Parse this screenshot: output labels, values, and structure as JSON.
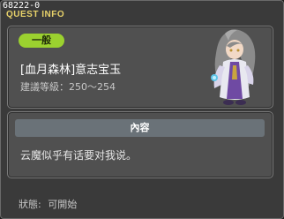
{
  "window": {
    "id_label": "68222-0",
    "title": "QUEST INFO"
  },
  "quest": {
    "category": "一般",
    "name": "[血月森林]意志宝玉",
    "level_text": "建議等級：250～254",
    "npc_icon": "npc-portrait-icon"
  },
  "content": {
    "header": "內容",
    "text": "云魔似乎有话要对我说。"
  },
  "status": {
    "label": "狀態:",
    "value": "可開始"
  },
  "colors": {
    "badge": "#9bd12f",
    "title": "#e8d26a",
    "panel": "#505050"
  }
}
